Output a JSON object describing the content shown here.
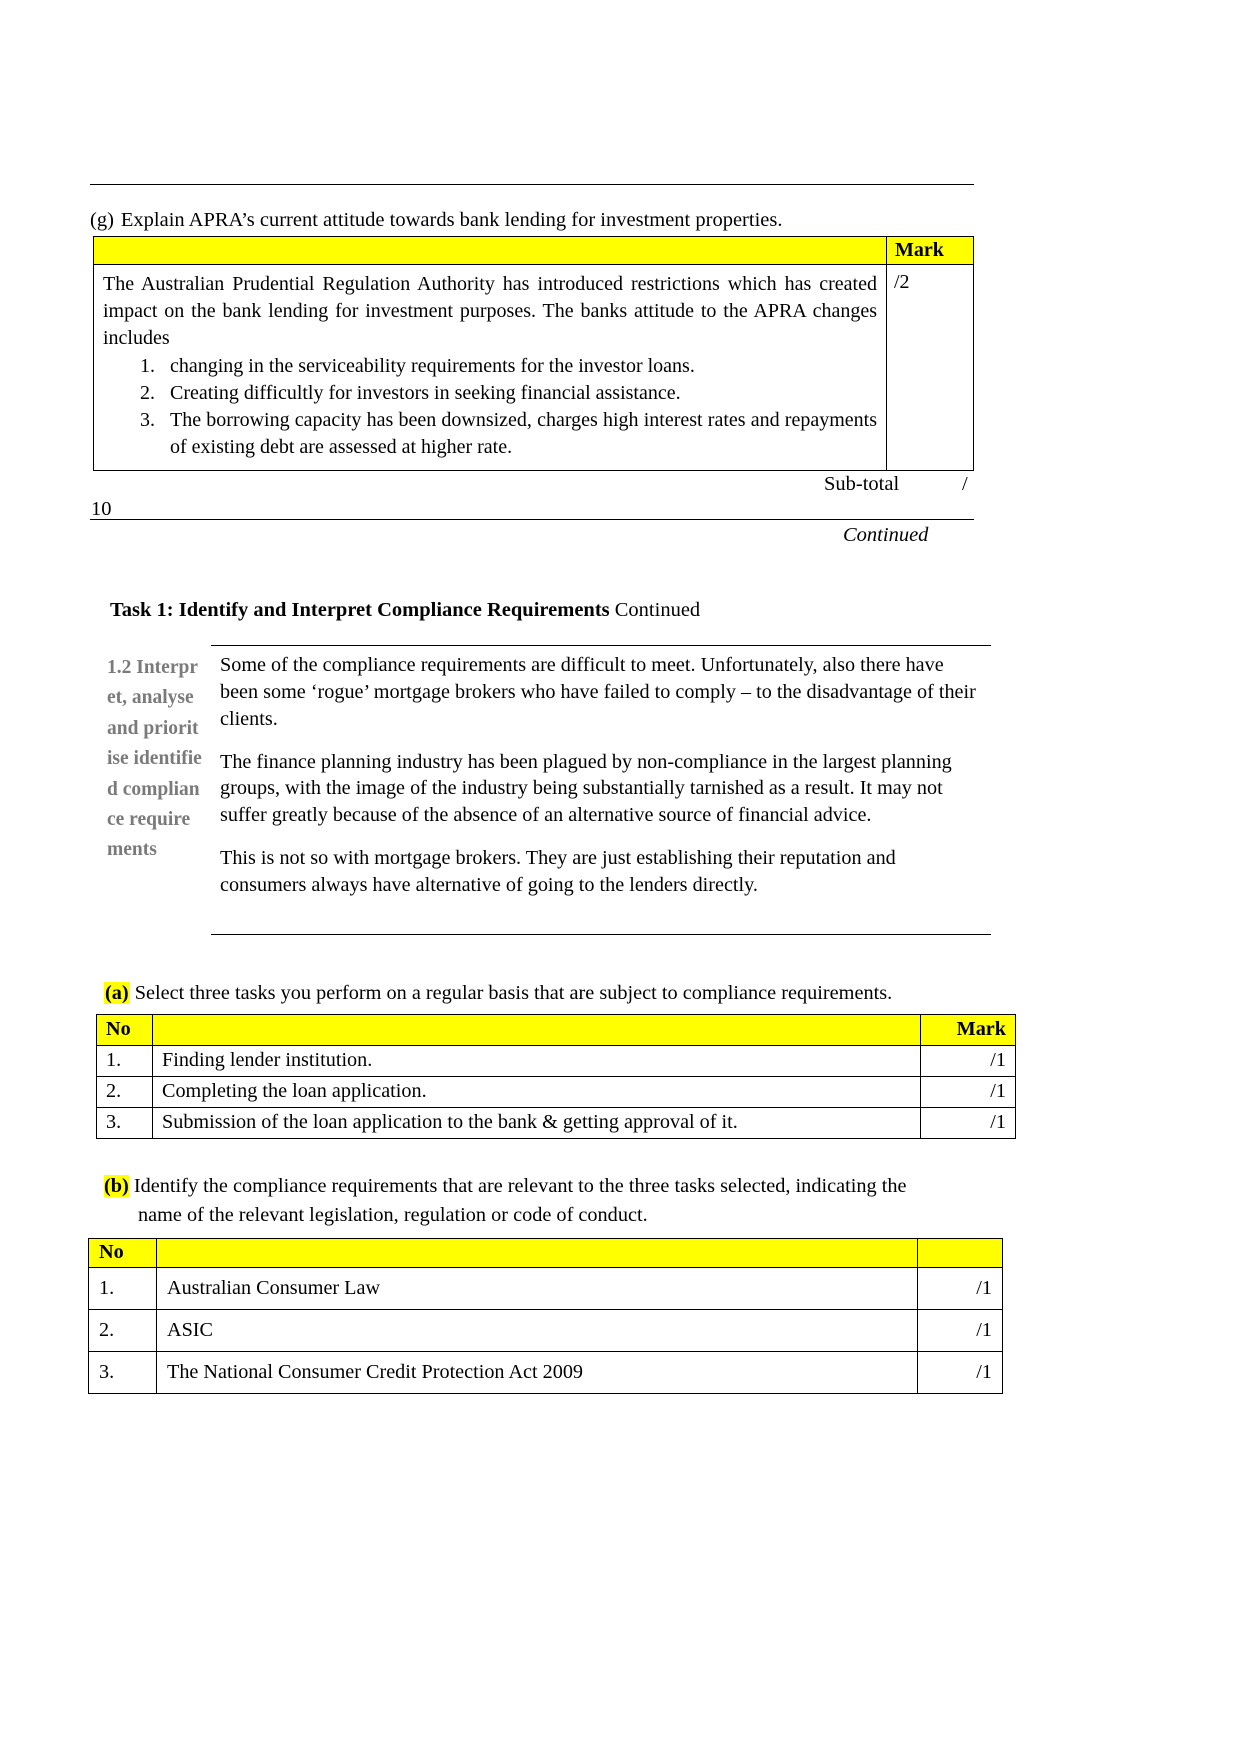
{
  "colors": {
    "highlight": "#ffff00",
    "sidebar_text": "#7a7a7a",
    "text": "#000000"
  },
  "question_g": {
    "label": "(g)",
    "prompt": "Explain APRA’s current attitude towards bank lending for investment properties.",
    "table": {
      "header_blank": "",
      "header_mark": "Mark",
      "answer_intro": "The Australian Prudential Regulation Authority has introduced restrictions which has created impact on the bank lending for investment purposes. The banks attitude to the APRA changes includes",
      "answer_items": [
        "changing in the serviceability requirements for the investor loans.",
        "Creating difficultly for investors in seeking financial assistance.",
        "The borrowing capacity has been downsized, charges high interest rates and repayments of existing debt are assessed at higher rate."
      ],
      "mark_value": "/2"
    }
  },
  "subtotal": {
    "label": "Sub-total",
    "slash": "/",
    "value": "10"
  },
  "footer": {
    "continued": "Continued"
  },
  "task_heading": {
    "title": "Task 1: Identify and Interpret Compliance Requirements",
    "suffix": "Continued"
  },
  "section_1_2": {
    "side_label": "1.2 Interpret, analyse and prioritise identified compliance requirements",
    "paragraphs": [
      "Some of the compliance requirements are difficult to meet. Unfortunately, also there have been some ‘rogue’ mortgage brokers who have failed to comply – to the disadvantage of their clients.",
      "The finance planning industry has been plagued by non-compliance in the largest planning groups, with the image of the industry being substantially tarnished as a result. It may not suffer greatly because of the absence of an alternative source of financial advice.",
      "This is not so with mortgage brokers. They are just establishing their reputation and consumers always have alternative of going to the lenders directly."
    ]
  },
  "question_a": {
    "label": "(a)",
    "prompt": "Select three tasks you perform on a regular basis that are subject to compliance requirements.",
    "table": {
      "headers": [
        "No",
        "",
        "Mark"
      ],
      "rows": [
        {
          "no": "1.",
          "text": "Finding lender institution.",
          "mark": "/1"
        },
        {
          "no": "2.",
          "text": "Completing the loan application.",
          "mark": "/1"
        },
        {
          "no": "3.",
          "text": "Submission of the loan application to the bank & getting approval of it.",
          "mark": "/1"
        }
      ]
    }
  },
  "question_b": {
    "label": "(b)",
    "prompt_line1": "Identify the compliance requirements that are relevant to the three tasks selected, indicating the",
    "prompt_line2": "name of the relevant legislation, regulation or code of conduct.",
    "table": {
      "headers": [
        "No",
        "",
        ""
      ],
      "rows": [
        {
          "no": "1.",
          "text": "Australian Consumer Law",
          "mark": "/1"
        },
        {
          "no": "2.",
          "text": "ASIC",
          "mark": "/1"
        },
        {
          "no": "3.",
          "text": "The National Consumer Credit Protection Act 2009",
          "mark": "/1"
        }
      ]
    }
  }
}
